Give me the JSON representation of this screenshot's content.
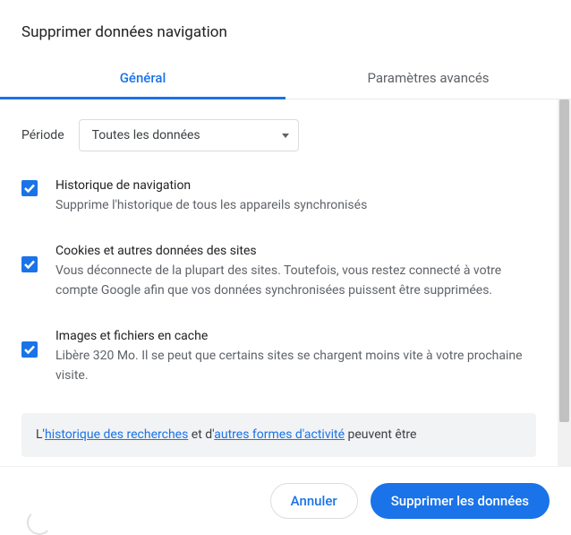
{
  "title": "Supprimer données navigation",
  "tabs": {
    "general": "Général",
    "advanced": "Paramètres avancés"
  },
  "period": {
    "label": "Période",
    "value": "Toutes les données"
  },
  "items": {
    "history": {
      "heading": "Historique de navigation",
      "desc": "Supprime l'historique de tous les appareils synchronisés"
    },
    "cookies": {
      "heading": "Cookies et autres données des sites",
      "desc": "Vous déconnecte de la plupart des sites. Toutefois, vous restez connecté à votre compte Google afin que vos données synchronisées puissent être supprimées."
    },
    "cache": {
      "heading": "Images et fichiers en cache",
      "desc": "Libère 320 Mo. Il se peut que certains sites se chargent moins vite à votre prochaine visite."
    }
  },
  "info": {
    "prefix": "L'",
    "link1": "historique des recherches",
    "mid": " et d'",
    "link2": "autres formes d'activité",
    "suffix": " peuvent être"
  },
  "footer": {
    "cancel": "Annuler",
    "delete": "Supprimer les données"
  }
}
